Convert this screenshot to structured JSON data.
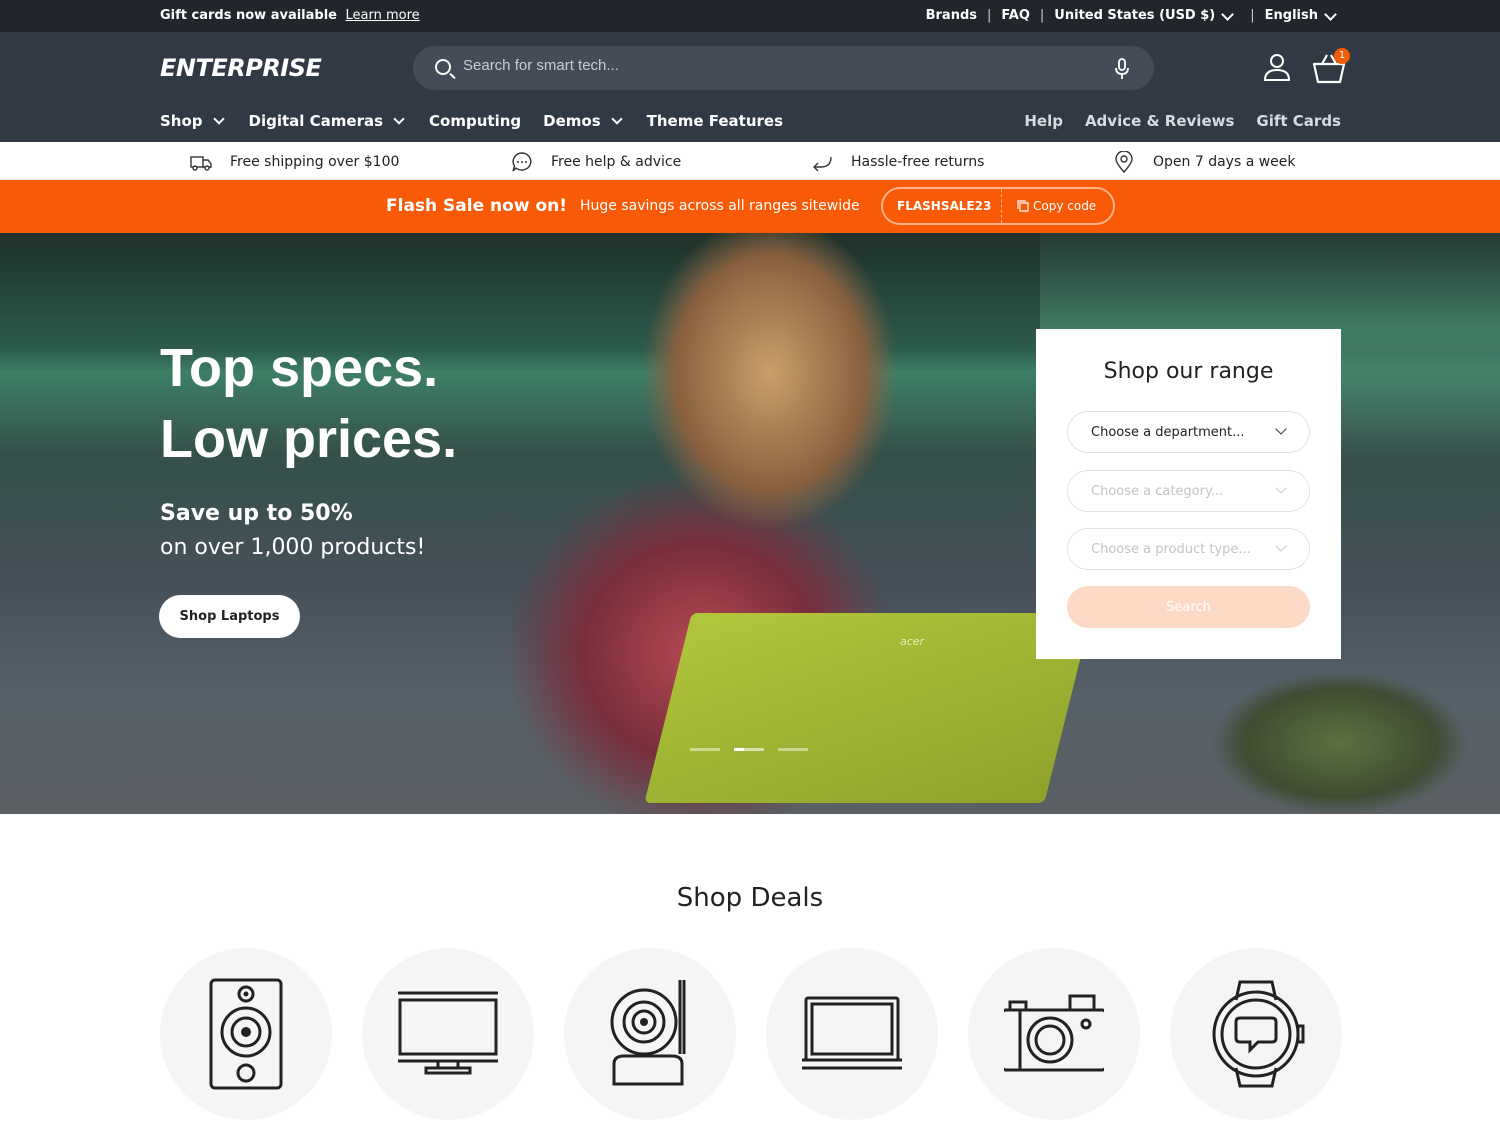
{
  "announcement": {
    "text": "Gift cards now available",
    "link": "Learn more",
    "brands": "Brands",
    "faq": "FAQ",
    "region": "United States (USD $)",
    "language": "English"
  },
  "header": {
    "logo": "ENTERPRISE",
    "search_placeholder": "Search for smart tech...",
    "cart_count": "1"
  },
  "nav": {
    "left": [
      "Shop",
      "Digital Cameras",
      "Computing",
      "Demos",
      "Theme Features"
    ],
    "right": [
      "Help",
      "Advice & Reviews",
      "Gift Cards"
    ]
  },
  "usp": [
    "Free shipping over $100",
    "Free help & advice",
    "Hassle-free returns",
    "Open 7 days a week"
  ],
  "flash": {
    "title": "Flash Sale now on!",
    "subtitle": "Huge savings across all ranges sitewide",
    "code": "FLASHSALE23",
    "copy": "Copy code"
  },
  "hero": {
    "line1": "Top specs.",
    "line2": "Low prices.",
    "sub1": "Save up to 50%",
    "sub2": "on over 1,000 products!",
    "button": "Shop Laptops",
    "laptop_brand": "acer"
  },
  "range": {
    "title": "Shop our range",
    "department": "Choose a department...",
    "category": "Choose a category...",
    "product_type": "Choose a product type...",
    "search": "Search"
  },
  "deals": {
    "title": "Shop Deals",
    "icons": [
      "speaker-icon",
      "monitor-icon",
      "webcam-icon",
      "laptop-icon",
      "camera-icon",
      "smartwatch-icon"
    ]
  },
  "colors": {
    "accent": "#f85a07",
    "header": "#303944",
    "topbar": "#21262c"
  }
}
